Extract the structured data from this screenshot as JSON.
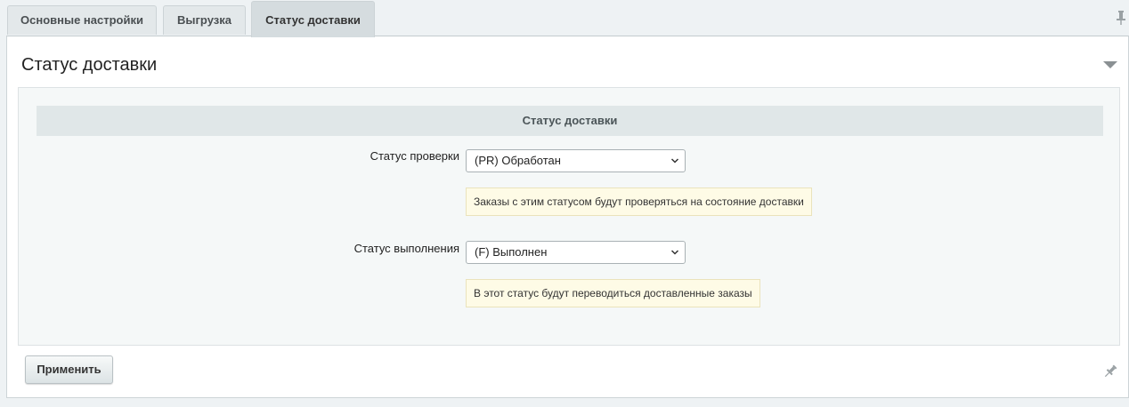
{
  "tabs": [
    {
      "label": "Основные настройки",
      "active": false
    },
    {
      "label": "Выгрузка",
      "active": false
    },
    {
      "label": "Статус доставки",
      "active": true
    }
  ],
  "panel": {
    "title": "Статус доставки",
    "section_header": "Статус доставки",
    "fields": [
      {
        "label": "Статус проверки",
        "value": "(PR) Обработан",
        "hint": "Заказы с этим статусом будут проверяться на состояние доставки"
      },
      {
        "label": "Статус выполнения",
        "value": "(F) Выполнен",
        "hint": "В этот статус будут переводиться доставленные заказы"
      }
    ]
  },
  "footer": {
    "apply_label": "Применить"
  },
  "icons": {
    "pin": "pin-icon",
    "collapse": "collapse-arrow-icon",
    "dropdown": "chevron-down-icon"
  },
  "colors": {
    "background": "#eef2f4",
    "section_header_bg": "#e0e7e8",
    "hint_bg": "#fefbe6"
  }
}
